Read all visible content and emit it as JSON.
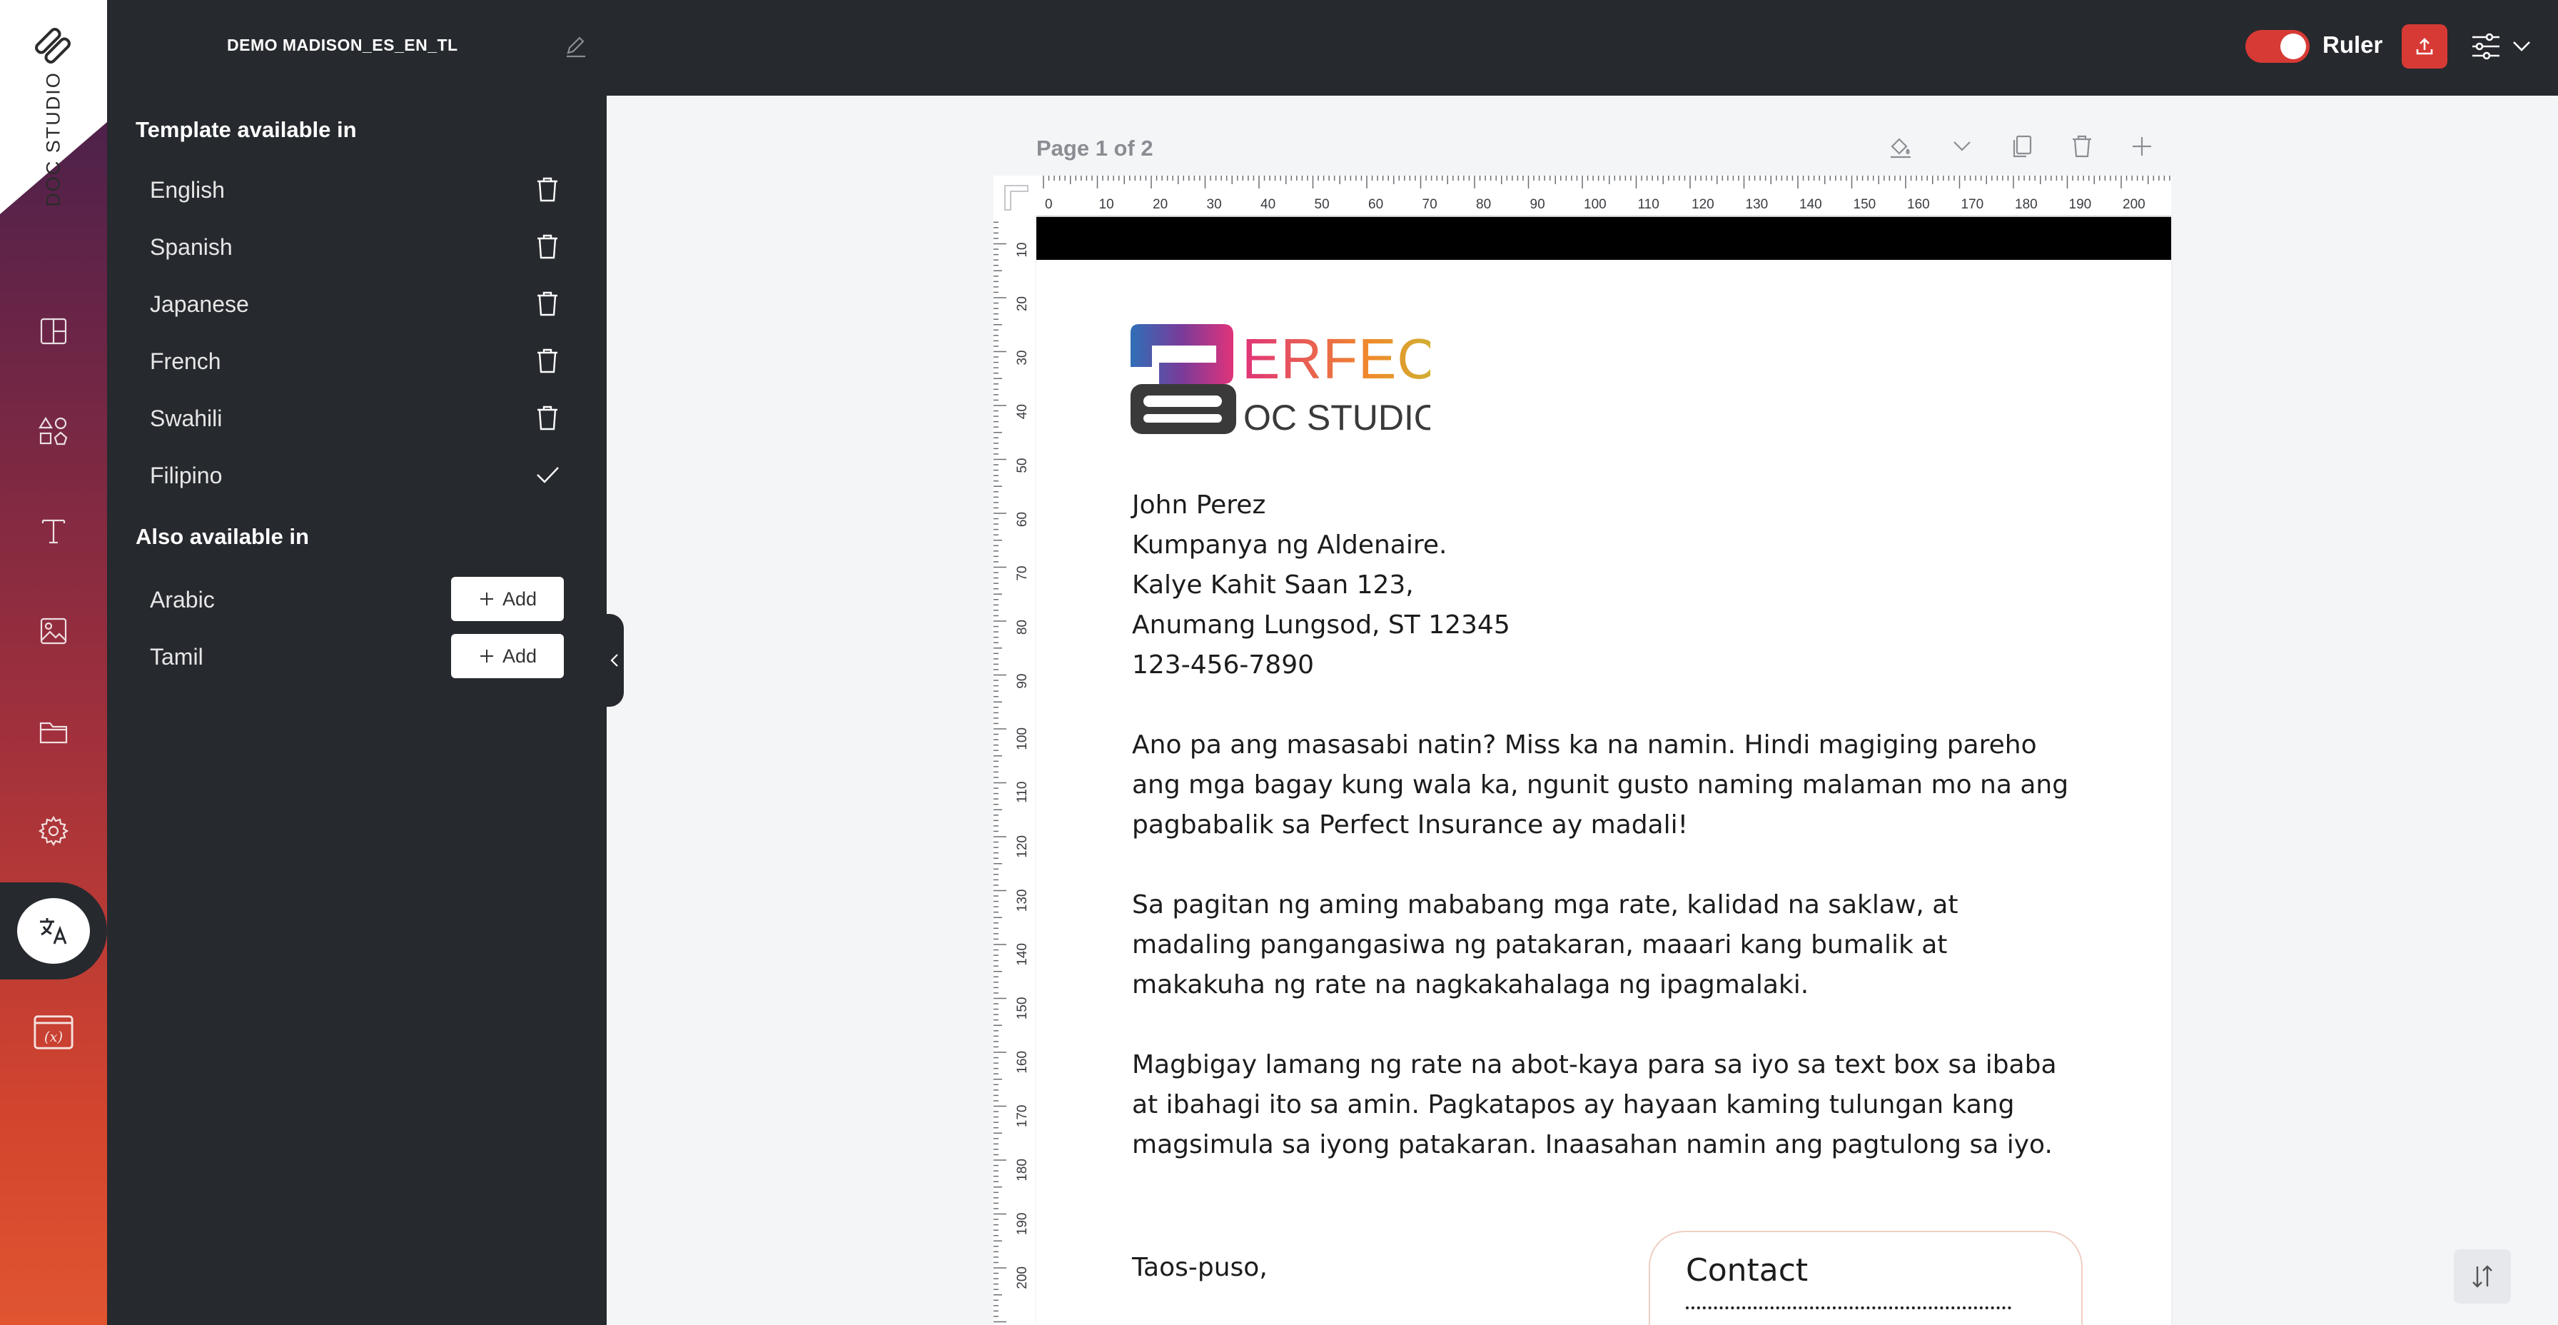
{
  "brand": {
    "name": "DOC STUDIO"
  },
  "header": {
    "doc_title": "DEMO MADISON_ES_EN_TL",
    "ruler_label": "Ruler",
    "ruler_enabled": true,
    "accent_color": "#d73a35"
  },
  "rail": {
    "items": [
      {
        "name": "layout-icon"
      },
      {
        "name": "shapes-icon"
      },
      {
        "name": "text-icon"
      },
      {
        "name": "image-icon"
      },
      {
        "name": "folder-icon"
      },
      {
        "name": "gear-icon"
      },
      {
        "name": "translate-icon",
        "active": true
      },
      {
        "name": "variable-icon"
      }
    ]
  },
  "panel": {
    "available_heading": "Template available in",
    "available": [
      {
        "label": "English",
        "action": "delete"
      },
      {
        "label": "Spanish",
        "action": "delete"
      },
      {
        "label": "Japanese",
        "action": "delete"
      },
      {
        "label": "French",
        "action": "delete"
      },
      {
        "label": "Swahili",
        "action": "delete"
      },
      {
        "label": "Filipino",
        "action": "selected"
      }
    ],
    "also_heading": "Also available in",
    "also": [
      {
        "label": "Arabic",
        "button": "Add"
      },
      {
        "label": "Tamil",
        "button": "Add"
      }
    ]
  },
  "canvas": {
    "page_label": "Page 1 of 2",
    "ruler_h_labels": [
      "0",
      "10",
      "20",
      "30",
      "40",
      "50",
      "60",
      "70",
      "80",
      "90",
      "100",
      "110",
      "120",
      "130",
      "140",
      "150",
      "160",
      "170",
      "180",
      "190",
      "200"
    ],
    "ruler_v_labels": [
      "10",
      "20",
      "30",
      "40",
      "50",
      "60",
      "70",
      "80",
      "90",
      "100",
      "110",
      "120",
      "130",
      "140",
      "150",
      "160",
      "170",
      "180",
      "190",
      "200"
    ]
  },
  "letter": {
    "logo_top": "ERFECT",
    "logo_bottom": "OC STUDIO",
    "address": [
      "John Perez",
      "Kumpanya ng Aldenaire.",
      "Kalye Kahit Saan 123,",
      "Anumang Lungsod, ST 12345",
      "123-456-7890"
    ],
    "para1": "Ano pa ang masasabi natin? Miss ka na namin. Hindi magiging pareho ang mga bagay kung wala ka, ngunit gusto naming malaman mo na ang pagbabalik sa Perfect Insurance ay madali!",
    "para2": "Sa pagitan ng aming mababang mga rate, kalidad na saklaw, at madaling pangangasiwa ng patakaran, maaari kang bumalik at makakuha ng rate na nagkakahalaga ng ipagmalaki.",
    "para3": "Magbigay lamang ng rate na abot-kaya para sa iyo sa text box sa ibaba at ibahagi ito sa amin. Pagkatapos ay hayaan kaming tulungan kang magsimula sa iyong patakaran. Inaasahan namin ang pagtulong sa iyo.",
    "closing": "Taos-puso,",
    "contact_title": "Contact"
  }
}
